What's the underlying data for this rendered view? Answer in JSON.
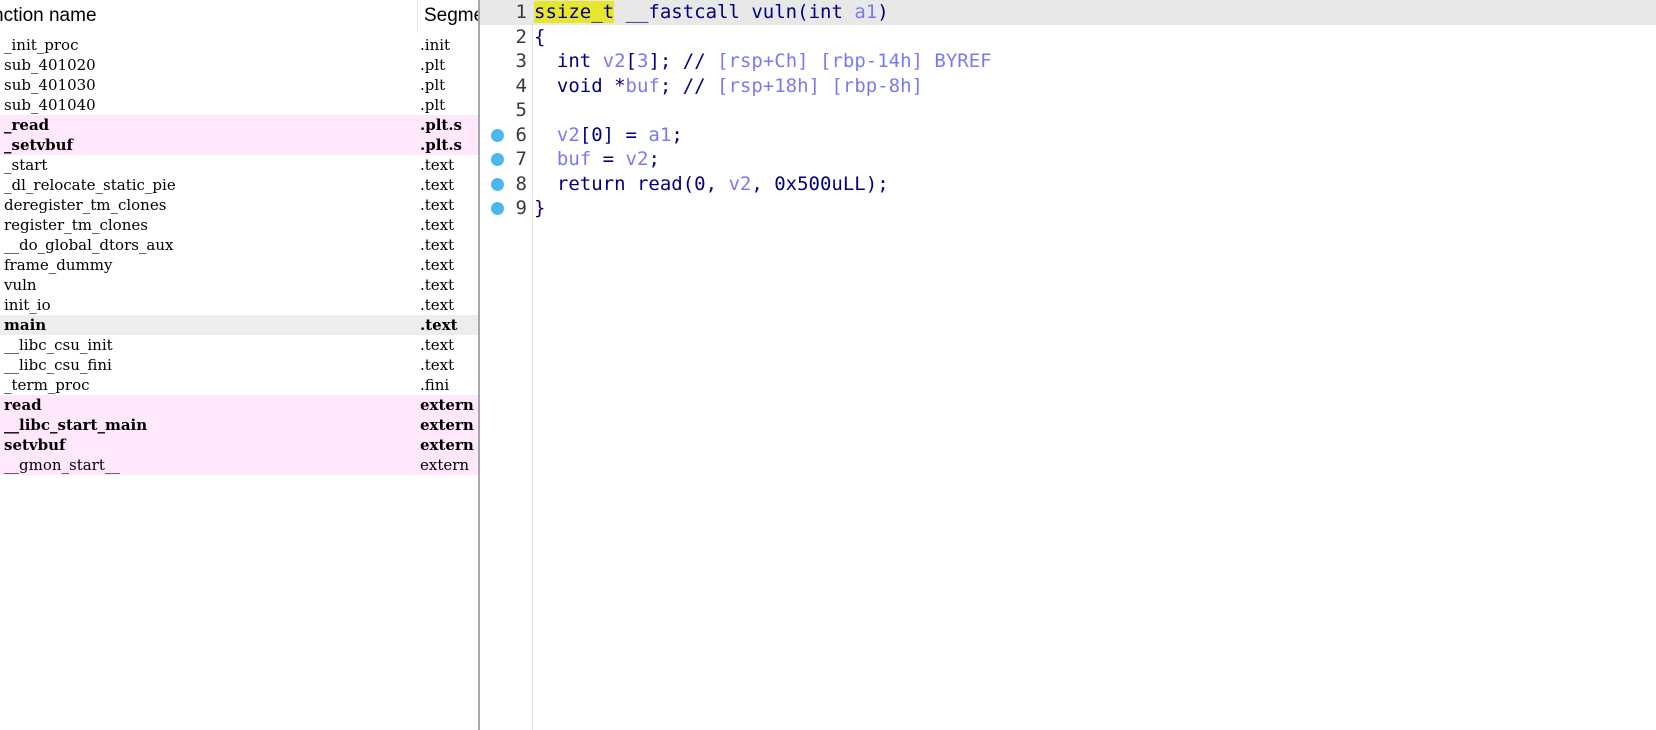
{
  "functions_panel": {
    "columns": {
      "name": "nction name",
      "segment": "Segme"
    },
    "rows": [
      {
        "name": "_init_proc",
        "segment": ".init",
        "style": "normal"
      },
      {
        "name": "sub_401020",
        "segment": ".plt",
        "style": "normal"
      },
      {
        "name": "sub_401030",
        "segment": ".plt",
        "style": "normal"
      },
      {
        "name": "sub_401040",
        "segment": ".plt",
        "style": "normal"
      },
      {
        "name": "_read",
        "segment": ".plt.s",
        "style": "import"
      },
      {
        "name": "_setvbuf",
        "segment": ".plt.s",
        "style": "import"
      },
      {
        "name": "_start",
        "segment": ".text",
        "style": "normal"
      },
      {
        "name": "_dl_relocate_static_pie",
        "segment": ".text",
        "style": "normal"
      },
      {
        "name": "deregister_tm_clones",
        "segment": ".text",
        "style": "normal"
      },
      {
        "name": "register_tm_clones",
        "segment": ".text",
        "style": "normal"
      },
      {
        "name": "__do_global_dtors_aux",
        "segment": ".text",
        "style": "normal"
      },
      {
        "name": "frame_dummy",
        "segment": ".text",
        "style": "normal"
      },
      {
        "name": "vuln",
        "segment": ".text",
        "style": "normal"
      },
      {
        "name": "init_io",
        "segment": ".text",
        "style": "normal"
      },
      {
        "name": "main",
        "segment": ".text",
        "style": "selected"
      },
      {
        "name": "__libc_csu_init",
        "segment": ".text",
        "style": "normal"
      },
      {
        "name": "__libc_csu_fini",
        "segment": ".text",
        "style": "normal"
      },
      {
        "name": "_term_proc",
        "segment": ".fini",
        "style": "normal"
      },
      {
        "name": "read",
        "segment": "extern",
        "style": "import"
      },
      {
        "name": "__libc_start_main",
        "segment": "extern",
        "style": "import"
      },
      {
        "name": "setvbuf",
        "segment": "extern",
        "style": "import"
      },
      {
        "name": "__gmon_start__",
        "segment": "extern",
        "style": "import-plain"
      }
    ]
  },
  "pseudocode": {
    "lines": [
      {
        "no": "1",
        "breakpoint": false,
        "current": true,
        "tokens": [
          {
            "t": "ssize_t",
            "c": "hl"
          },
          {
            "t": " __fastcall ",
            "c": "kw"
          },
          {
            "t": "vuln",
            "c": "kw"
          },
          {
            "t": "(int ",
            "c": "kw"
          },
          {
            "t": "a1",
            "c": "var"
          },
          {
            "t": ")",
            "c": "kw"
          }
        ]
      },
      {
        "no": "2",
        "breakpoint": false,
        "current": false,
        "tokens": [
          {
            "t": "{",
            "c": "kw"
          }
        ]
      },
      {
        "no": "3",
        "breakpoint": false,
        "current": false,
        "tokens": [
          {
            "t": "  int ",
            "c": "kw"
          },
          {
            "t": "v2",
            "c": "var"
          },
          {
            "t": "[",
            "c": "kw"
          },
          {
            "t": "3",
            "c": "var"
          },
          {
            "t": "]; // ",
            "c": "kw"
          },
          {
            "t": "[rsp+Ch] [rbp-14h] BYREF",
            "c": "cmt"
          }
        ]
      },
      {
        "no": "4",
        "breakpoint": false,
        "current": false,
        "tokens": [
          {
            "t": "  void *",
            "c": "kw"
          },
          {
            "t": "buf",
            "c": "var"
          },
          {
            "t": "; // ",
            "c": "kw"
          },
          {
            "t": "[rsp+18h] [rbp-8h]",
            "c": "cmt"
          }
        ]
      },
      {
        "no": "5",
        "breakpoint": false,
        "current": false,
        "tokens": []
      },
      {
        "no": "6",
        "breakpoint": true,
        "current": false,
        "tokens": [
          {
            "t": "  ",
            "c": "kw"
          },
          {
            "t": "v2",
            "c": "var"
          },
          {
            "t": "[0] = ",
            "c": "kw"
          },
          {
            "t": "a1",
            "c": "var"
          },
          {
            "t": ";",
            "c": "kw"
          }
        ]
      },
      {
        "no": "7",
        "breakpoint": true,
        "current": false,
        "tokens": [
          {
            "t": "  ",
            "c": "kw"
          },
          {
            "t": "buf",
            "c": "var"
          },
          {
            "t": " = ",
            "c": "kw"
          },
          {
            "t": "v2",
            "c": "var"
          },
          {
            "t": ";",
            "c": "kw"
          }
        ]
      },
      {
        "no": "8",
        "breakpoint": true,
        "current": false,
        "tokens": [
          {
            "t": "  return read(0, ",
            "c": "kw"
          },
          {
            "t": "v2",
            "c": "var"
          },
          {
            "t": ", 0x500uLL);",
            "c": "kw"
          }
        ]
      },
      {
        "no": "9",
        "breakpoint": true,
        "current": false,
        "tokens": [
          {
            "t": "}",
            "c": "kw"
          }
        ]
      }
    ]
  },
  "colors": {
    "import_row_bg": "#ffe8fb",
    "selected_row_bg": "#ededed",
    "breakpoint": "#4cb6ef",
    "code_keyword": "#000080",
    "code_variable": "#7a7af0",
    "highlight": "#e6e62e"
  }
}
